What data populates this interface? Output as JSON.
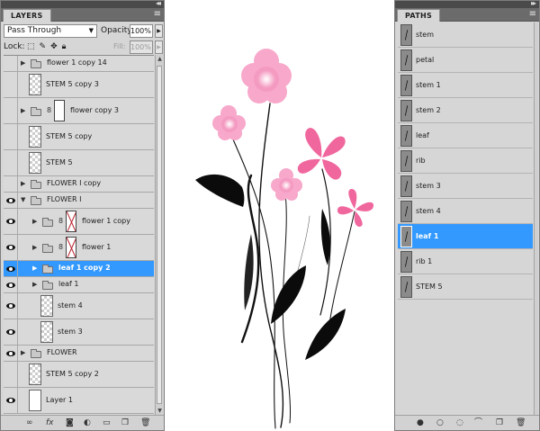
{
  "layers_panel": {
    "tab_label": "LAYERS",
    "blend_mode": "Pass Through",
    "opacity_label": "Opacity:",
    "opacity_value": "100%",
    "lock_label": "Lock:",
    "fill_label": "Fill:",
    "fill_value": "100%",
    "layers": [
      {
        "name": "flower 1 copy 14",
        "type": "group",
        "visible": false,
        "expanded": false,
        "indent": 0,
        "selected": false,
        "tall": false
      },
      {
        "name": "STEM 5 copy 3",
        "type": "layer",
        "visible": false,
        "indent": 0,
        "selected": false,
        "tall": true
      },
      {
        "name": "flower copy 3",
        "type": "group-mask",
        "visible": false,
        "expanded": false,
        "indent": 0,
        "selected": false,
        "tall": true
      },
      {
        "name": "STEM 5 copy",
        "type": "layer",
        "visible": false,
        "indent": 0,
        "selected": false,
        "tall": true
      },
      {
        "name": "STEM 5",
        "type": "layer",
        "visible": false,
        "indent": 0,
        "selected": false,
        "tall": true
      },
      {
        "name": "FLOWER I copy",
        "type": "group",
        "visible": false,
        "expanded": false,
        "indent": 0,
        "selected": false,
        "tall": false
      },
      {
        "name": "FLOWER I",
        "type": "group",
        "visible": true,
        "expanded": true,
        "indent": 0,
        "selected": false,
        "tall": false
      },
      {
        "name": "flower 1 copy",
        "type": "group-mask",
        "visible": true,
        "expanded": false,
        "indent": 1,
        "selected": false,
        "tall": true
      },
      {
        "name": "flower 1",
        "type": "group-mask",
        "visible": true,
        "expanded": false,
        "indent": 1,
        "selected": false,
        "tall": true
      },
      {
        "name": "leaf 1 copy 2",
        "type": "group",
        "visible": true,
        "expanded": false,
        "indent": 1,
        "selected": true,
        "tall": false
      },
      {
        "name": "leaf 1",
        "type": "group",
        "visible": true,
        "expanded": false,
        "indent": 1,
        "selected": false,
        "tall": false
      },
      {
        "name": "stem 4",
        "type": "layer",
        "visible": true,
        "indent": 1,
        "selected": false,
        "tall": true
      },
      {
        "name": "stem 3",
        "type": "layer",
        "visible": true,
        "indent": 1,
        "selected": false,
        "tall": true
      },
      {
        "name": "FLOWER",
        "type": "group",
        "visible": true,
        "expanded": false,
        "indent": 0,
        "selected": false,
        "tall": false
      },
      {
        "name": "STEM 5 copy 2",
        "type": "layer",
        "visible": false,
        "indent": 0,
        "selected": false,
        "tall": true
      },
      {
        "name": "Layer 1",
        "type": "layer-white",
        "visible": true,
        "indent": 0,
        "selected": false,
        "tall": true
      }
    ],
    "bottom_icons": [
      "link-icon",
      "fx-icon",
      "mask-icon",
      "adjustment-icon",
      "new-group-icon",
      "new-layer-icon",
      "trash-icon"
    ]
  },
  "paths_panel": {
    "tab_label": "PATHS",
    "paths": [
      {
        "name": "stem",
        "selected": false
      },
      {
        "name": "petal",
        "selected": false
      },
      {
        "name": "stem 1",
        "selected": false
      },
      {
        "name": "stem 2",
        "selected": false
      },
      {
        "name": "leaf",
        "selected": false
      },
      {
        "name": "rib",
        "selected": false
      },
      {
        "name": "stem 3",
        "selected": false
      },
      {
        "name": "stem 4",
        "selected": false
      },
      {
        "name": "leaf 1",
        "selected": true
      },
      {
        "name": "rib 1",
        "selected": false
      },
      {
        "name": "STEM 5",
        "selected": false
      }
    ],
    "bottom_icons": [
      "fill-path-icon",
      "stroke-path-icon",
      "load-selection-icon",
      "make-work-path-icon",
      "new-path-icon",
      "trash-icon"
    ]
  },
  "colors": {
    "selection": "#3399ff",
    "petal_outer": "#f59ac2",
    "petal_core": "#ffffff",
    "leaf": "#0b0b0b"
  }
}
